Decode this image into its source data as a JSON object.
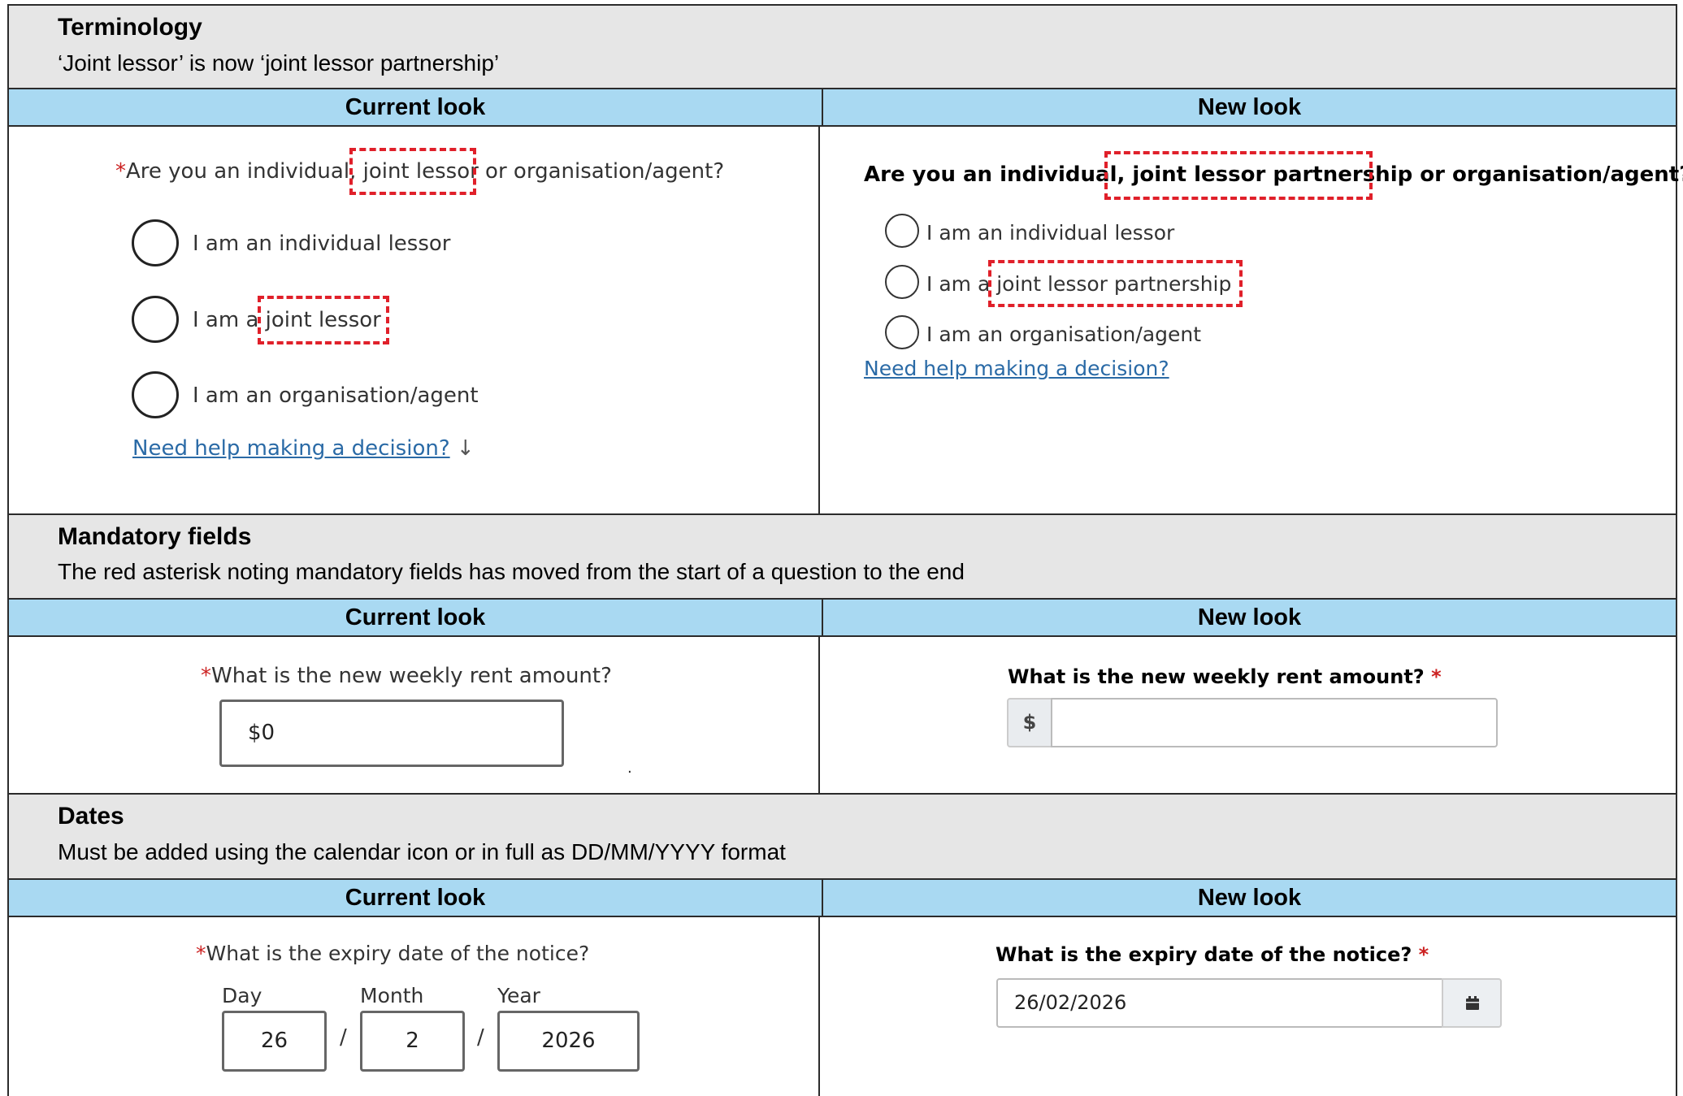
{
  "sections": {
    "terminology": {
      "title": "Terminology",
      "desc": "‘Joint lessor’ is now ‘joint lessor partnership’"
    },
    "mandatory": {
      "title": "Mandatory fields",
      "desc": "The red asterisk noting mandatory fields has moved from the start of a question to the end"
    },
    "dates": {
      "title": "Dates",
      "desc": "Must be added using the calendar icon or in full as DD/MM/YYYY format"
    }
  },
  "header_labels": {
    "current": "Current look",
    "new": "New look"
  },
  "asterisk": "*",
  "terminology_current": {
    "q_a": "Are you an individual, ",
    "q_b": "joint lessor",
    "q_c": " or organisation/agent?",
    "opt1": "I am an individual lessor",
    "opt2_a": "I am a ",
    "opt2_b": "joint lessor",
    "opt3": "I am an organisation/agent",
    "help": "Need help making a decision?",
    "help_arrow": "↓"
  },
  "terminology_new": {
    "q_a": "Are you an individual, ",
    "q_b": "joint lessor partnership",
    "q_c": " or organisation/agent?",
    "opt1": "I am an individual lessor",
    "opt2_a": "I am a ",
    "opt2_b": "joint lessor partnership",
    "opt3": "I am an organisation/agent",
    "help": "Need help making a decision?"
  },
  "rent_current": {
    "question": "What is the new weekly rent amount?",
    "value": "$0",
    "stray_dot": "."
  },
  "rent_new": {
    "question": "What is the new weekly rent amount? ",
    "prefix": "$",
    "value": ""
  },
  "dates_current": {
    "question": "What is the expiry date of the notice?",
    "day_label": "Day",
    "month_label": "Month",
    "year_label": "Year",
    "day": "26",
    "month": "2",
    "year": "2026",
    "separator": "/"
  },
  "dates_new": {
    "question": "What is the expiry date of the notice? ",
    "value": "26/02/2026",
    "calendar_icon": "calendar-icon"
  }
}
